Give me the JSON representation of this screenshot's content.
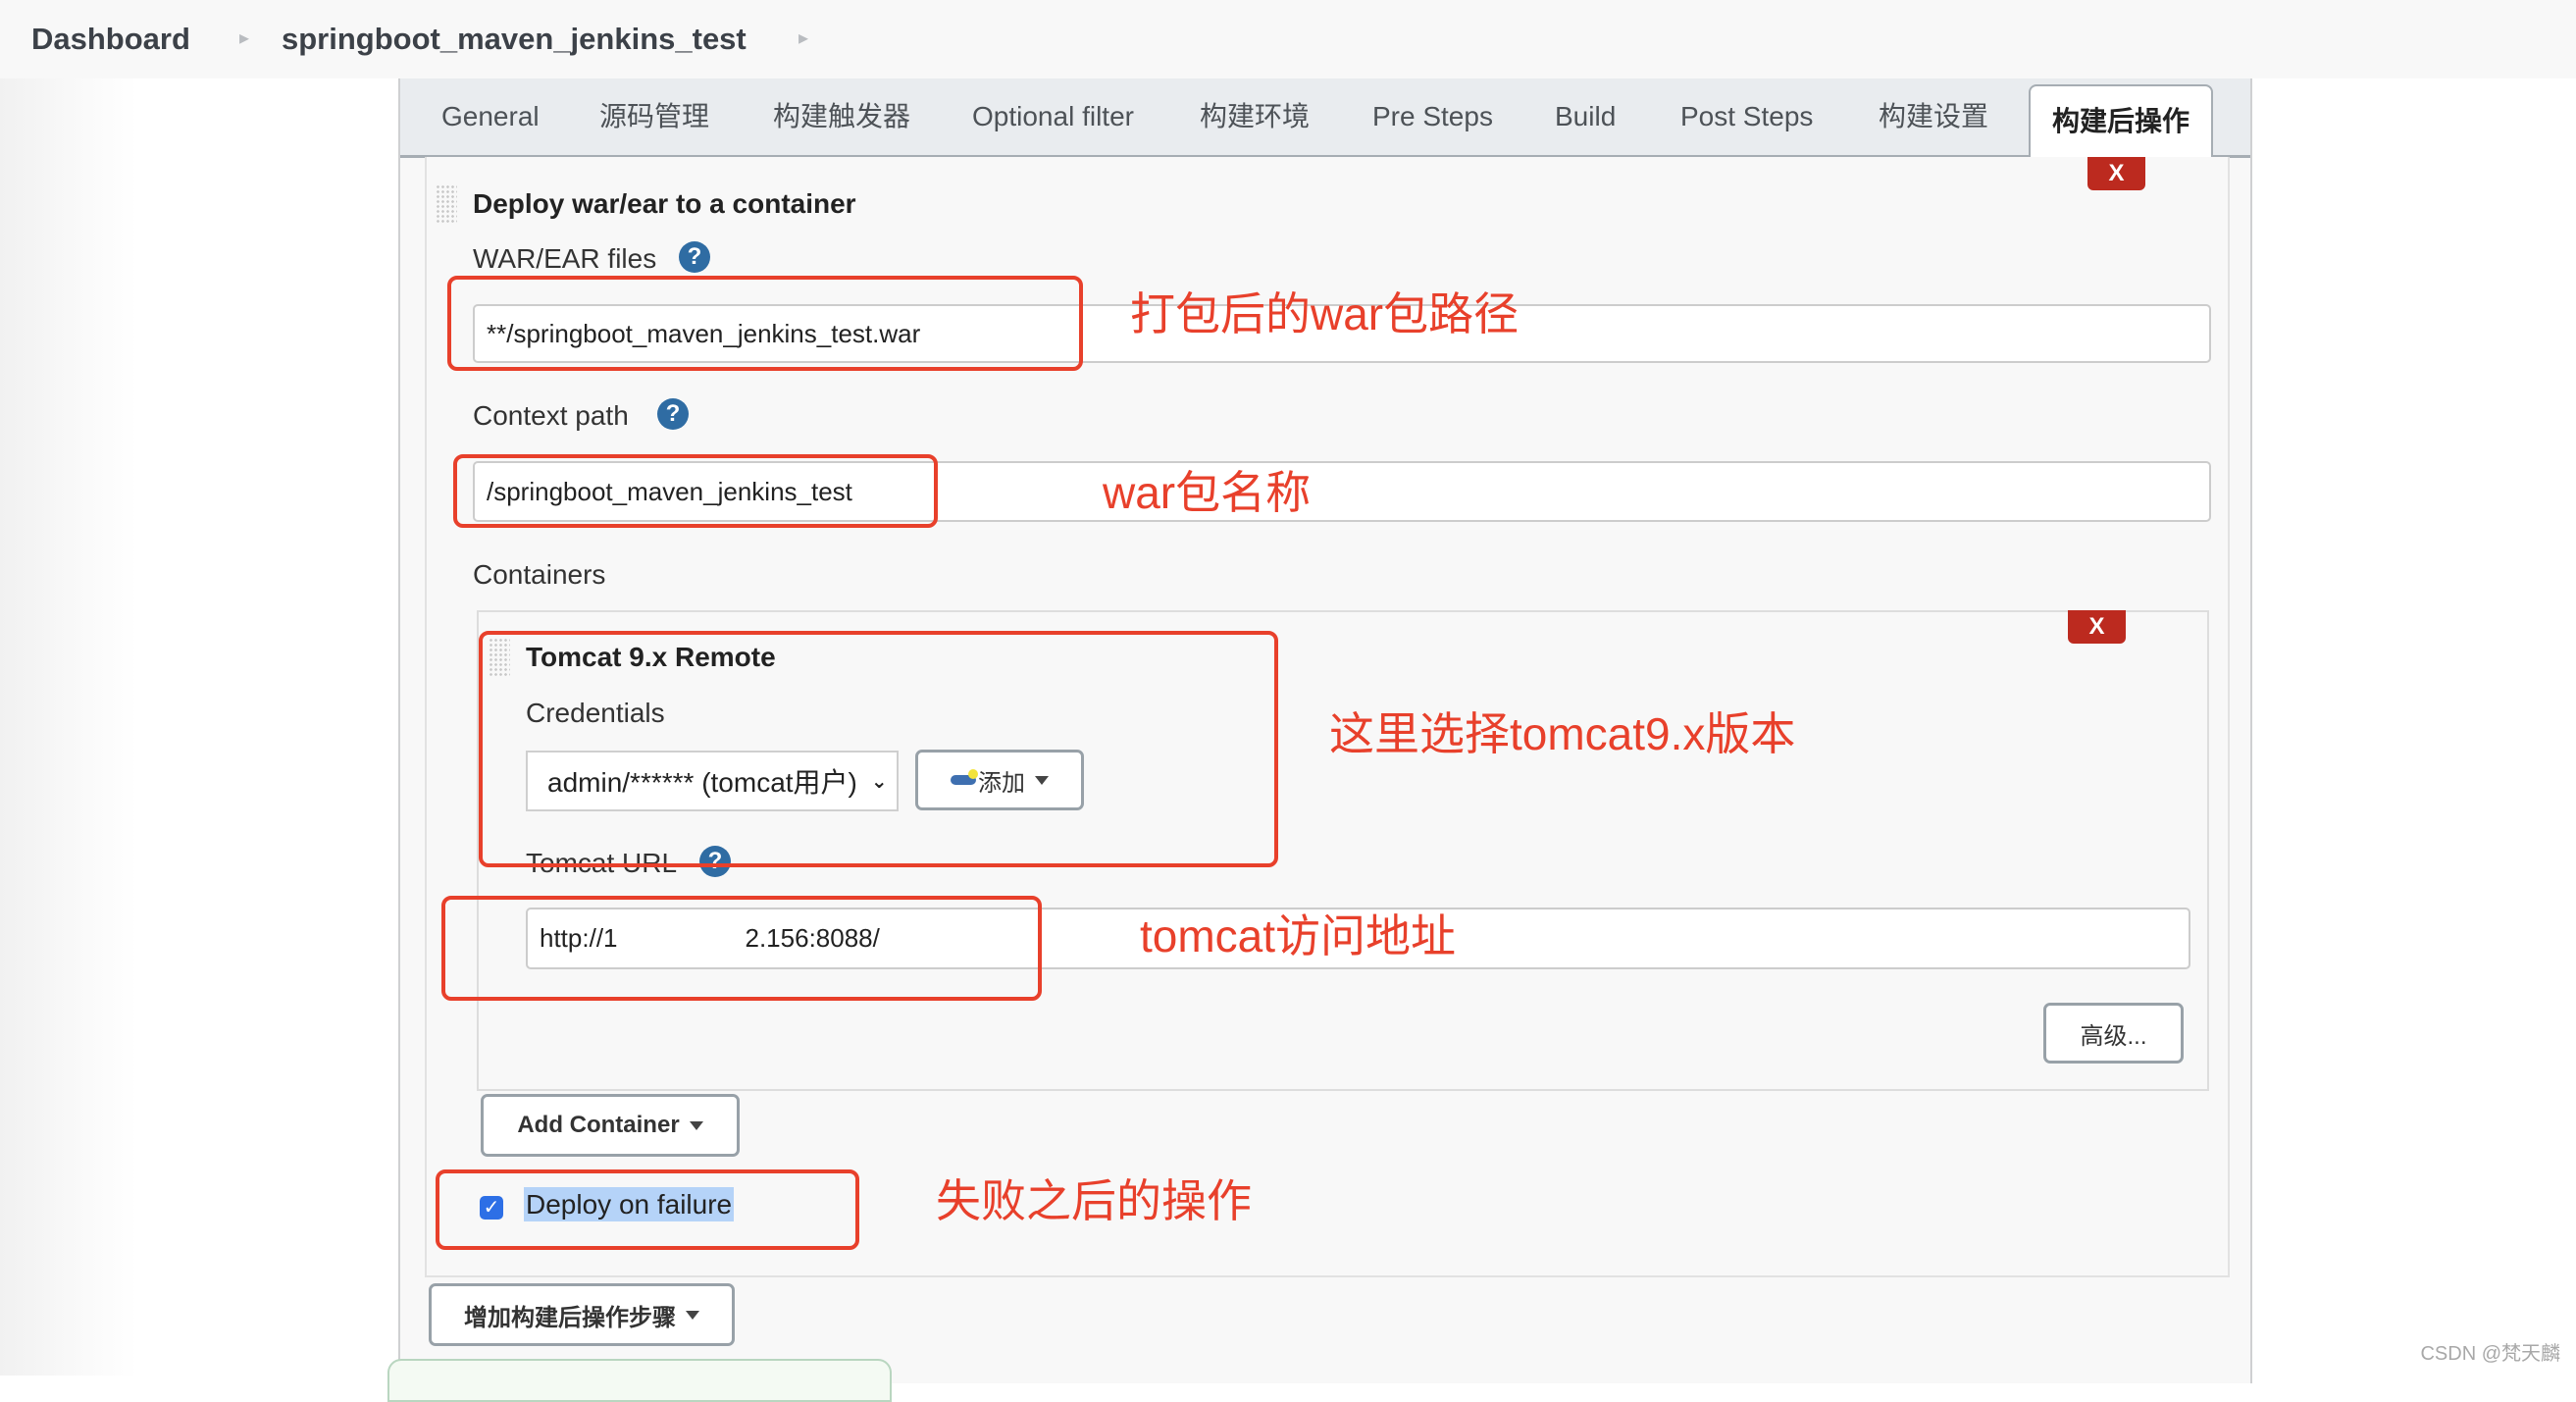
{
  "breadcrumb": {
    "items": [
      "Dashboard",
      "springboot_maven_jenkins_test"
    ]
  },
  "tabs": [
    {
      "label": "General",
      "active": false
    },
    {
      "label": "源码管理",
      "active": false
    },
    {
      "label": "构建触发器",
      "active": false
    },
    {
      "label": "Optional filter",
      "active": false
    },
    {
      "label": "构建环境",
      "active": false
    },
    {
      "label": "Pre Steps",
      "active": false
    },
    {
      "label": "Build",
      "active": false
    },
    {
      "label": "Post Steps",
      "active": false
    },
    {
      "label": "构建设置",
      "active": false
    },
    {
      "label": "构建后操作",
      "active": true
    }
  ],
  "deploy_section": {
    "title": "Deploy war/ear to a container",
    "delete_label": "X",
    "war_files": {
      "label": "WAR/EAR files",
      "help": "?",
      "value": "**/springboot_maven_jenkins_test.war"
    },
    "context_path": {
      "label": "Context path",
      "help": "?",
      "value": "/springboot_maven_jenkins_test"
    },
    "containers_label": "Containers",
    "container": {
      "title": "Tomcat 9.x Remote",
      "delete_label": "X",
      "credentials_label": "Credentials",
      "credentials_selected": "admin/****** (tomcat用户)",
      "add_button_label": "添加",
      "tomcat_url_label": "Tomcat URL",
      "tomcat_url_help": "?",
      "tomcat_url_prefix": "http://1",
      "tomcat_url_suffix": "2.156:8088/",
      "advanced_button_label": "高级..."
    },
    "add_container_label": "Add Container",
    "deploy_on_failure": {
      "label": "Deploy on failure",
      "checked": true
    }
  },
  "add_post_build_step_label": "增加构建后操作步骤",
  "annotations": {
    "war_path": "打包后的war包路径",
    "war_name": "war包名称",
    "tomcat_version": "这里选择tomcat9.x版本",
    "tomcat_url": "tomcat访问地址",
    "on_failure": "失败之后的操作"
  },
  "watermark": "CSDN @梵天麟",
  "colors": {
    "annotation_red": "#e8402b",
    "delete_red": "#bc2a1f",
    "help_blue": "#2f6ca3",
    "checkbox_blue": "#2d6fe6"
  }
}
